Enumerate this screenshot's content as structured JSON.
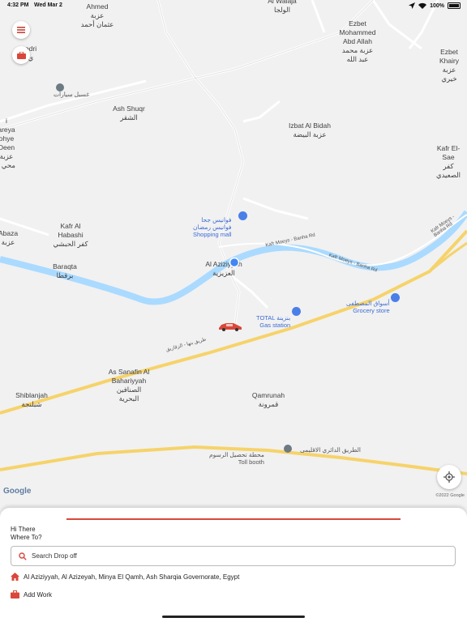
{
  "status_bar": {
    "time": "4:32 PM",
    "date": "Wed Mar 2",
    "battery": "100%"
  },
  "map": {
    "places": [
      {
        "id": "ahmed",
        "text": "Ahmed\nعزبة\nعثمان أحمد"
      },
      {
        "id": "walaja",
        "text": "Al Walaja\nالولجا"
      },
      {
        "id": "ezbet-mohammed",
        "text": "Ezbet\nMohammed\nAbd Allah\nعزبة محمد\nعبد الله"
      },
      {
        "id": "ezbet-khairy",
        "text": "Ezbet Khairy\nعزبة خيري"
      },
      {
        "id": "ash-shuqr",
        "text": "Ash Shuqr\nالشقر"
      },
      {
        "id": "izbat-bidah",
        "text": "Izbat Al Bidah\nعزبة البيضة"
      },
      {
        "id": "kafr-el-sae",
        "text": "Kafr El-Sae\nكفر الصعيدي"
      },
      {
        "id": "kafr-habashi",
        "text": "Kafr Al\nHabashi\nكفر الحبشي"
      },
      {
        "id": "abaza",
        "text": "Abaza\nعزبة"
      },
      {
        "id": "baraqta",
        "text": "Baraqta\nبرقطا"
      },
      {
        "id": "aziziyyah",
        "text": "Al Aziziyyah\nالعزيزية"
      },
      {
        "id": "sanafin",
        "text": "As Sanafin Al\nBahariyyah\nالصنافين\nالبحرية"
      },
      {
        "id": "shiblanjah",
        "text": "Shiblanjah\nشبلنجة"
      },
      {
        "id": "qamrunah",
        "text": "Qamrunah\nقمرونة"
      },
      {
        "id": "left-edge",
        "text": "i\nareya\nohye\nDeen\nعزبة\nمحي ا"
      },
      {
        "id": "left-top",
        "text": "edri\nي"
      }
    ],
    "pois": [
      {
        "id": "car-wash",
        "text": "غسيل سيارات"
      },
      {
        "id": "fawanees",
        "text": "فوانيس جحا\nفوانيس رمضان\nShopping mall"
      },
      {
        "id": "total",
        "text": "TOTAL بنزينة\nGas station"
      },
      {
        "id": "grocery",
        "text": "أسواق المصطفى\nGrocery store"
      },
      {
        "id": "toll",
        "text": "محطة تحصيل الرسوم\nToll booth"
      },
      {
        "id": "ring-road",
        "text": "الطريق الدائري الاقليمى"
      }
    ],
    "roads": [
      {
        "id": "kafr-moeys-1",
        "text": "Kafr Moeys - Banha Rd"
      },
      {
        "id": "kafr-moeys-2",
        "text": "Kafr Moeys - Banha Rd"
      },
      {
        "id": "kafr-moeys-3",
        "text": "Kafr Moeys - Banha Rd"
      },
      {
        "id": "banha-zagazig",
        "text": "طريق بنها - الزقازيق"
      }
    ],
    "google_logo": "Google",
    "copyright": "©2022 Google"
  },
  "sheet": {
    "greeting": "Hi There",
    "question": "Where To?",
    "search_placeholder": "Search Drop off",
    "home_address": "Al Aziziyyah, Al Azizeyah, Minya El Qamh, Ash Sharqia Governorate, Egypt",
    "add_work": "Add Work"
  },
  "colors": {
    "accent": "#d9473b",
    "water": "#aadaff",
    "highway": "#f6d36a"
  }
}
